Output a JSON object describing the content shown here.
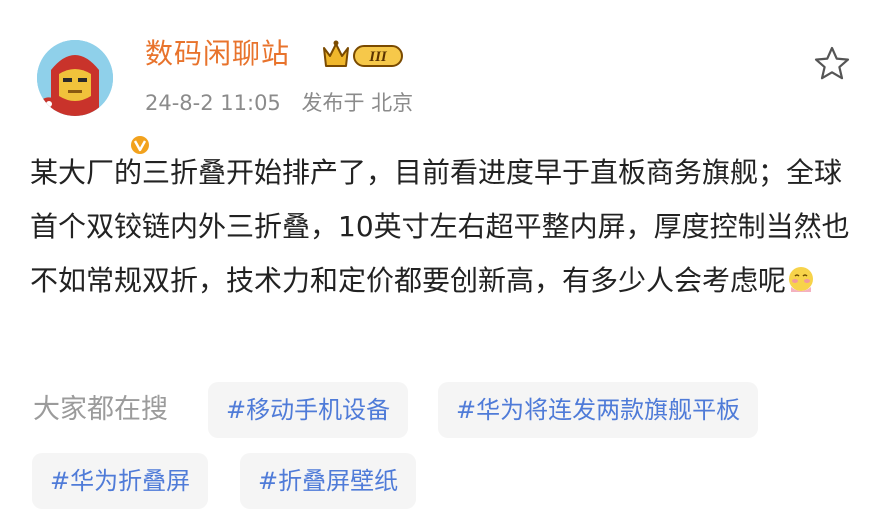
{
  "user": {
    "name": "数码闲聊站",
    "level_badge": "III",
    "date": "24-8-2 11:05",
    "location": "发布于 北京"
  },
  "post": {
    "text": "某大厂的三折叠开始排产了，目前看进度早于直板商务旗舰；全球首个双铰链内外三折叠，10英寸左右超平整内屏，厚度控制当然也不如常规双折，技术力和定价都要创新高，有多少人会考虑呢"
  },
  "search": {
    "label": "大家都在搜",
    "tags": [
      "#移动手机设备",
      "#华为将连发两款旗舰平板",
      "#华为折叠屏",
      "#折叠屏壁纸"
    ]
  },
  "colors": {
    "username": "#e8732c",
    "tag_text": "#4f7bd8",
    "tag_bg": "#f5f5f5",
    "meta": "#8b8b8b"
  },
  "icons": [
    "avatar-ironman",
    "verified-v-icon",
    "crown-level-icon",
    "star-outline-icon",
    "blushing-emoji-icon"
  ]
}
